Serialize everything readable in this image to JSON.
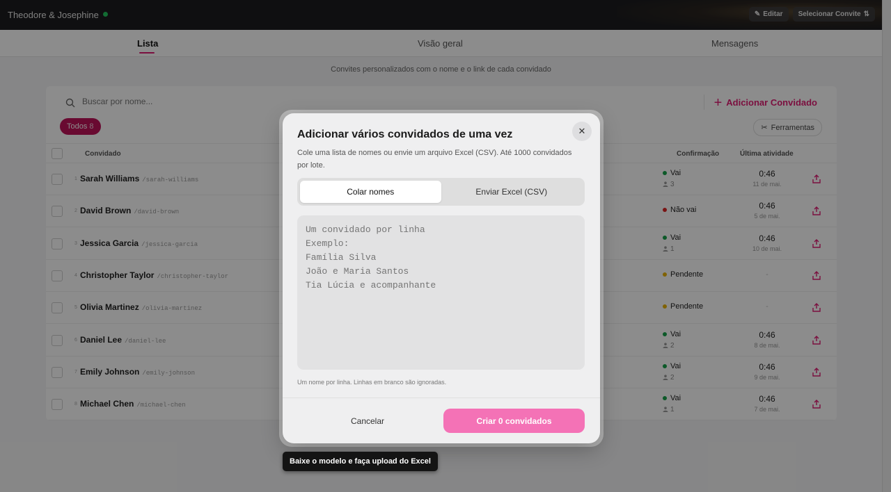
{
  "header": {
    "couple_name": "Theodore & Josephine",
    "edit_label": "Editar",
    "select_invite_label": "Selecionar Convite"
  },
  "tabs": [
    {
      "label": "Lista",
      "active": true
    },
    {
      "label": "Visão geral",
      "active": false
    },
    {
      "label": "Mensagens",
      "active": false
    }
  ],
  "subtitle": "Convites personalizados com o nome e o link de cada convidado",
  "search": {
    "placeholder": "Buscar por nome..."
  },
  "add_guest_label": "Adicionar Convidado",
  "filter": {
    "label": "Todos",
    "count": "8"
  },
  "tools_label": "Ferramentas",
  "table": {
    "headers": {
      "guest": "Convidado",
      "confirmation": "Confirmação",
      "last_activity": "Última atividade"
    },
    "rows": [
      {
        "index": "1",
        "name": "Sarah Williams",
        "slug": "/sarah-williams",
        "status": "Vai",
        "status_color": "#16a34a",
        "companions": "3",
        "time": "0:46",
        "date": "11 de mai."
      },
      {
        "index": "2",
        "name": "David Brown",
        "slug": "/david-brown",
        "status": "Não vai",
        "status_color": "#dc2626",
        "companions": "",
        "time": "0:46",
        "date": "5 de mai."
      },
      {
        "index": "3",
        "name": "Jessica Garcia",
        "slug": "/jessica-garcia",
        "status": "Vai",
        "status_color": "#16a34a",
        "companions": "1",
        "time": "0:46",
        "date": "10 de mai."
      },
      {
        "index": "4",
        "name": "Christopher Taylor",
        "slug": "/christopher-taylor",
        "status": "Pendente",
        "status_color": "#eab308",
        "companions": "",
        "time": "",
        "date": "-"
      },
      {
        "index": "5",
        "name": "Olivia Martinez",
        "slug": "/olivia-martinez",
        "status": "Pendente",
        "status_color": "#eab308",
        "companions": "",
        "time": "",
        "date": "-"
      },
      {
        "index": "6",
        "name": "Daniel Lee",
        "slug": "/daniel-lee",
        "status": "Vai",
        "status_color": "#16a34a",
        "companions": "2",
        "time": "0:46",
        "date": "8 de mai."
      },
      {
        "index": "7",
        "name": "Emily Johnson",
        "slug": "/emily-johnson",
        "status": "Vai",
        "status_color": "#16a34a",
        "companions": "2",
        "time": "0:46",
        "date": "9 de mai."
      },
      {
        "index": "8",
        "name": "Michael Chen",
        "slug": "/michael-chen",
        "status": "Vai",
        "status_color": "#16a34a",
        "companions": "1",
        "time": "0:46",
        "date": "7 de mai."
      }
    ]
  },
  "modal": {
    "title": "Adicionar vários convidados de uma vez",
    "description": "Cole uma lista de nomes ou envie um arquivo Excel (CSV). Até 1000 convidados por lote.",
    "tab_paste": "Colar nomes",
    "tab_upload": "Enviar Excel (CSV)",
    "textarea_placeholder": "Um convidado por linha\nExemplo:\nFamília Silva\nJoão e Maria Santos\nTia Lúcia e acompanhante",
    "hint": "Um nome por linha. Linhas em branco são ignoradas.",
    "cancel_label": "Cancelar",
    "create_label": "Criar 0 convidados"
  },
  "tooltip": "Baixe o modelo e faça upload do Excel",
  "colors": {
    "accent": "#e11d74",
    "accent_dark": "#c0135a",
    "create_button": "#f472b6"
  }
}
